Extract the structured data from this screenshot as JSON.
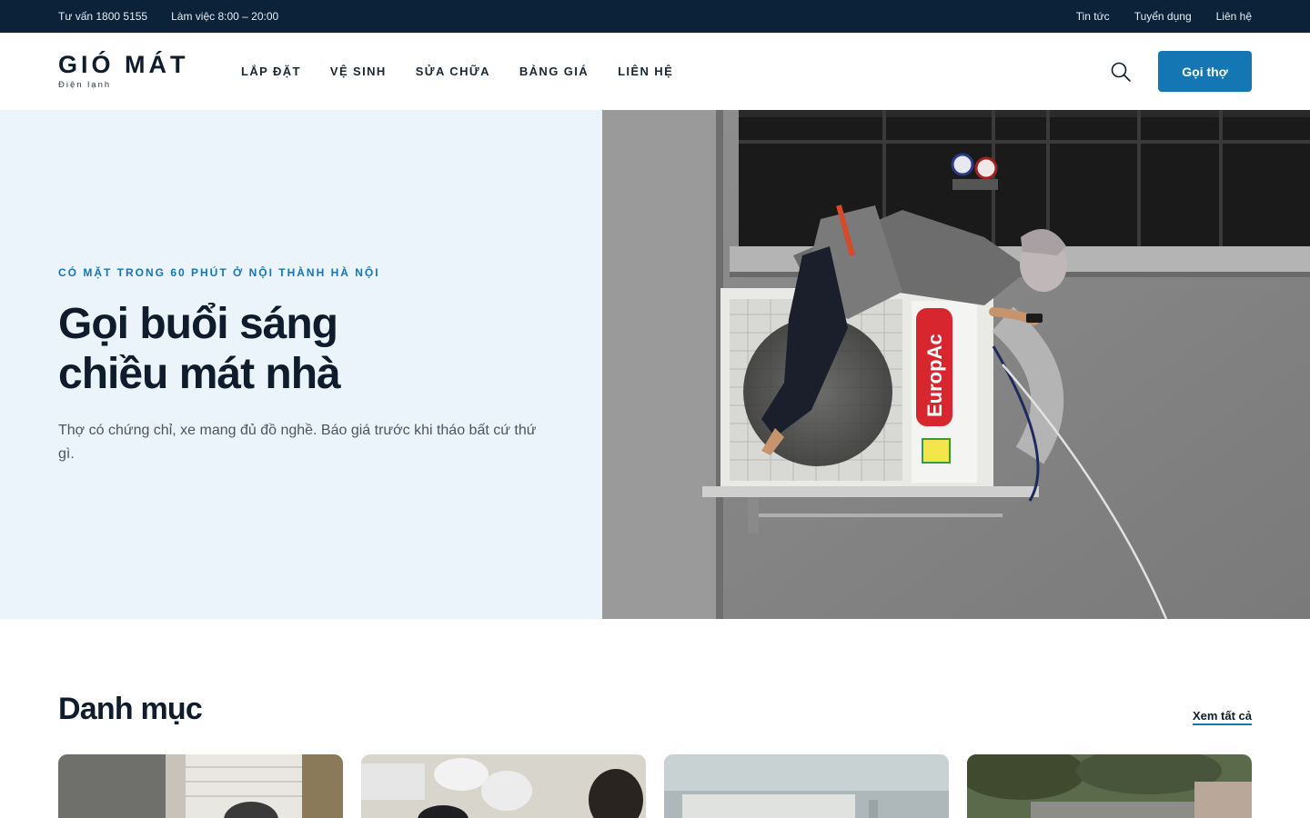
{
  "topbar": {
    "hotline": "Tư vấn 1800 5155",
    "hours": "Làm việc 8:00 – 20:00",
    "links": [
      "Tin tức",
      "Tuyển dụng",
      "Liên hệ"
    ]
  },
  "brand": {
    "name": "GIÓ MÁT",
    "tagline": "Điện lạnh"
  },
  "nav": [
    "LẮP ĐẶT",
    "VỆ SINH",
    "SỬA CHỮA",
    "BẢNG GIÁ",
    "LIÊN HỆ"
  ],
  "header": {
    "search_icon": "search-icon",
    "cta": "Gọi thợ"
  },
  "hero": {
    "eyebrow": "CÓ MẶT TRONG 60 PHÚT Ở NỘI THÀNH HÀ NỘI",
    "title": "Gọi buổi sáng chiều mát nhà",
    "description": "Thợ có chứng chỉ, xe mang đủ đồ nghề. Báo giá trước khi tháo bất cứ thứ gì.",
    "unit_brand": "EuropAc"
  },
  "categories": {
    "title": "Danh mục",
    "see_all": "Xem tất cả"
  },
  "colors": {
    "topbar": "#0c2238",
    "accent": "#1576b4",
    "hero_bg": "#ebf3fb",
    "text": "#0f1c2b"
  }
}
